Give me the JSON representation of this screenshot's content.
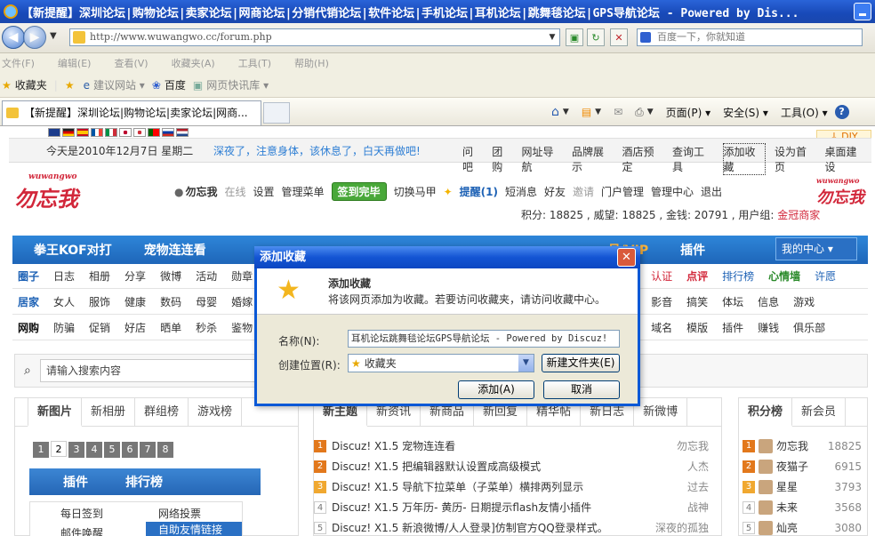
{
  "browser": {
    "window_title": "【新提醒】深圳论坛|购物论坛|卖家论坛|网商论坛|分销代销论坛|软件论坛|手机论坛|耳机论坛|跳舞毯论坛|GPS导航论坛 - Powered by Dis...",
    "address": "http://www.wuwangwo.cc/forum.php",
    "search_placeholder": "百度一下，你就知道",
    "menu": [
      "文件(F)",
      "编辑(E)",
      "查看(V)",
      "收藏夹(A)",
      "工具(T)",
      "帮助(H)"
    ],
    "favorites": {
      "label": "收藏夹",
      "items": [
        "建议网站 ▾",
        "百度",
        "网页快讯库 ▾"
      ]
    },
    "tab_title": "【新提醒】深圳论坛|购物论坛|卖家论坛|网商...",
    "commands": [
      "页面(P) ▾",
      "安全(S) ▾",
      "工具(O) ▾"
    ]
  },
  "page": {
    "diy": "↓ DIY",
    "date": "今天是2010年12月7日 星期二",
    "tip": "深夜了，注意身体，该休息了，白天再做吧!",
    "toplinks": [
      "问吧",
      "团购",
      "网址导航",
      "品牌展示",
      "酒店预定",
      "查询工具",
      "添加收藏",
      "设为首页",
      "桌面建设"
    ],
    "logo_text": "勿忘我",
    "logo_small": "wuwangwo",
    "user": {
      "name": "勿忘我",
      "status": "在线",
      "settings": "设置",
      "admin": "管理菜单",
      "sign": "签到完毕",
      "vest": "切换马甲",
      "remind": "提醒(1)",
      "sms": "短消息",
      "friends": "好友",
      "invite": "邀请",
      "portal": "门户管理",
      "center": "管理中心",
      "logout": "退出"
    },
    "credits": "积分: 18825 , 威望: 18825 , 金钱: 20791 , 用户组: ",
    "usergroup": "金冠商家",
    "nav": [
      "拳王KOF对打",
      "宠物连连看",
      "员/VIP",
      "插件"
    ],
    "mycenter": "我的中心 ▾",
    "subnav1": {
      "head": "圈子",
      "items": [
        "日志",
        "相册",
        "分享",
        "微博",
        "活动",
        "勋章"
      ],
      "right": [
        "认证",
        "点评",
        "排行榜",
        "心情墙",
        "许愿"
      ]
    },
    "subnav2": {
      "head": "居家",
      "items": [
        "女人",
        "服饰",
        "健康",
        "数码",
        "母婴",
        "婚嫁"
      ],
      "right": [
        "影音",
        "搞笑",
        "体坛",
        "信息",
        "游戏"
      ]
    },
    "subnav3": {
      "head": "网购",
      "items": [
        "防骗",
        "促销",
        "好店",
        "晒单",
        "秒杀",
        "鉴物"
      ],
      "right": [
        "域名",
        "模版",
        "插件",
        "赚钱",
        "俱乐部"
      ]
    },
    "search_placeholder": "请输入搜索内容",
    "left_tabs": [
      "新图片",
      "新相册",
      "群组榜",
      "游戏榜"
    ],
    "pages": [
      "1",
      "2",
      "3",
      "4",
      "5",
      "6",
      "7",
      "8"
    ],
    "plugin_tabs": [
      "插件",
      "排行榜"
    ],
    "plugin_items": [
      "每日签到",
      "网络投票",
      "邮件唤醒",
      "自助友情链接"
    ],
    "mid_tabs": [
      "新主题",
      "新资讯",
      "新商品",
      "新回复",
      "精华帖",
      "新日志",
      "新微博"
    ],
    "threads": [
      {
        "n": "1",
        "title": "Discuz! X1.5 宠物连连看",
        "author": "勿忘我"
      },
      {
        "n": "2",
        "title": "Discuz! X1.5 把编辑器默认设置成高级模式",
        "author": "人杰"
      },
      {
        "n": "3",
        "title": "Discuz! X1.5 导航下拉菜单（子菜单）横排两列显示",
        "author": "过去"
      },
      {
        "n": "4",
        "title": "Discuz! X1.5 万年历- 黄历- 日期提示flash友情小插件",
        "author": "战神"
      },
      {
        "n": "5",
        "title": "Discuz! X1.5 新浪微博/人人登录]仿制官方QQ登录样式。",
        "author": "深夜的孤独"
      }
    ],
    "right_tabs": [
      "积分榜",
      "新会员"
    ],
    "ranks": [
      {
        "n": "1",
        "name": "勿忘我",
        "score": "18825"
      },
      {
        "n": "2",
        "name": "夜猫子",
        "score": "6915"
      },
      {
        "n": "3",
        "name": "星星",
        "score": "3793"
      },
      {
        "n": "4",
        "name": "未来",
        "score": "3568"
      },
      {
        "n": "5",
        "name": "灿亮",
        "score": "3080"
      }
    ]
  },
  "dialog": {
    "title": "添加收藏",
    "heading": "添加收藏",
    "description": "将该网页添加为收藏。若要访问收藏夹，请访问收藏中心。",
    "name_label": "名称(N):",
    "name_value": "耳机论坛跳舞毯论坛GPS导航论坛 - Powered by Discuz!",
    "location_label": "创建位置(R):",
    "location_value": "收藏夹",
    "new_folder": "新建文件夹(E)",
    "add": "添加(A)",
    "cancel": "取消"
  },
  "colors": {
    "xp_blue": "#0a58d6",
    "nav_blue": "#1e66b9",
    "accent_red": "#d2273a",
    "link_blue": "#2d7ed4"
  }
}
